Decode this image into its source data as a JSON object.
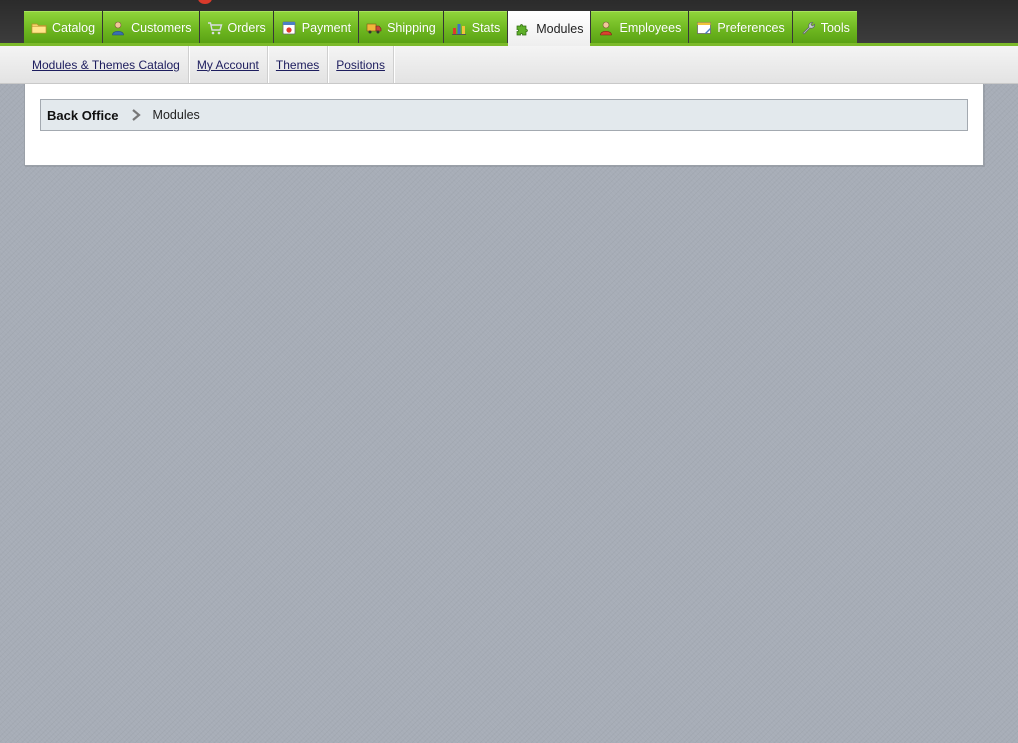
{
  "main_tabs": [
    {
      "label": "Catalog",
      "icon": "folder-icon",
      "active": false
    },
    {
      "label": "Customers",
      "icon": "customer-icon",
      "active": false
    },
    {
      "label": "Orders",
      "icon": "cart-icon",
      "active": false
    },
    {
      "label": "Payment",
      "icon": "payment-icon",
      "active": false
    },
    {
      "label": "Shipping",
      "icon": "truck-icon",
      "active": false
    },
    {
      "label": "Stats",
      "icon": "bar-chart-icon",
      "active": false
    },
    {
      "label": "Modules",
      "icon": "puzzle-icon",
      "active": true
    },
    {
      "label": "Employees",
      "icon": "employee-icon",
      "active": false
    },
    {
      "label": "Preferences",
      "icon": "preferences-icon",
      "active": false
    },
    {
      "label": "Tools",
      "icon": "wrench-icon",
      "active": false
    }
  ],
  "sub_tabs": [
    {
      "label": "Modules & Themes Catalog"
    },
    {
      "label": "My Account"
    },
    {
      "label": "Themes"
    },
    {
      "label": "Positions"
    }
  ],
  "breadcrumb": {
    "root": "Back Office",
    "current": "Modules",
    "separator_icon": "chevron-right-icon"
  },
  "colors": {
    "tab_green": "#6cb51f",
    "header_dark": "#333333",
    "accent_line": "#7cba2a",
    "background": "#a7adb7",
    "breadcrumb_bg": "#e3e9ed"
  }
}
